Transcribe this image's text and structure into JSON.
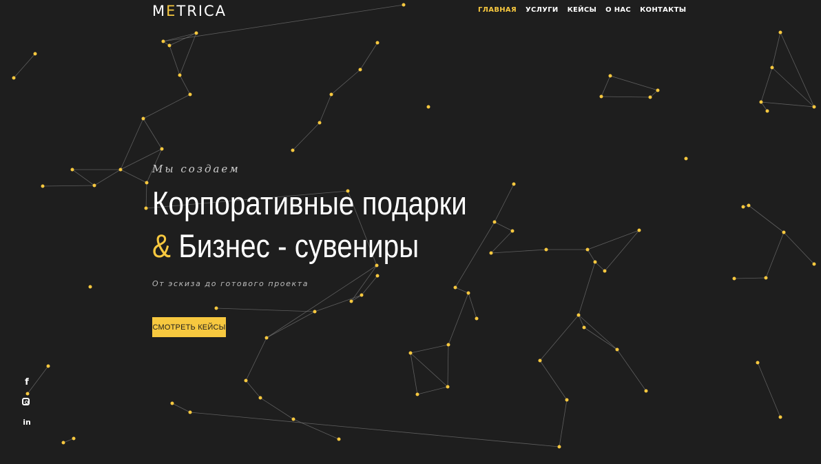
{
  "logo": {
    "prefix": "M",
    "accent": "E",
    "suffix": "TRICA"
  },
  "nav": [
    {
      "label": "ГЛАВНАЯ",
      "active": true
    },
    {
      "label": "УСЛУГИ",
      "active": false
    },
    {
      "label": "КЕЙСЫ",
      "active": false
    },
    {
      "label": "О НАС",
      "active": false
    },
    {
      "label": "КОНТАКТЫ",
      "active": false
    }
  ],
  "hero": {
    "kicker": "Мы создаем",
    "title_line1": "Корпоративные подарки",
    "title_amp": "&",
    "title_line2": "Бизнес - сувениры",
    "subtitle": "От эскиза до готового проекта",
    "cta": "СМОТРЕТЬ КЕЙСЫ"
  },
  "social": [
    {
      "icon": "facebook-icon",
      "glyph": "f"
    },
    {
      "icon": "instagram-icon",
      "glyph": ""
    },
    {
      "icon": "linkedin-icon",
      "glyph": "in"
    }
  ],
  "colors": {
    "background": "#1e1e1e",
    "accent": "#f7c83f",
    "line": "#7a7a7a"
  }
}
